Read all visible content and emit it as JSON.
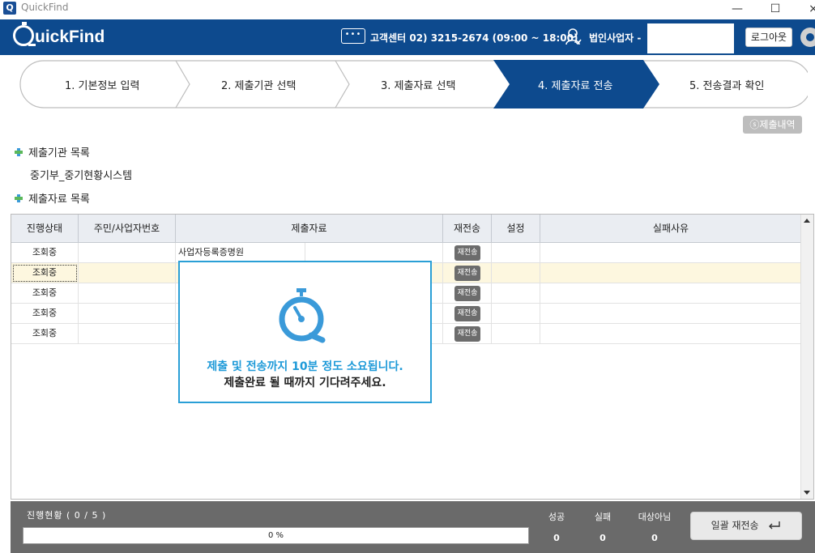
{
  "window": {
    "title": "QuickFind",
    "app_icon_glyph": "Q",
    "minimize": "—",
    "maximize": "☐",
    "close": "×"
  },
  "header": {
    "logo": "uickFind",
    "chat_glyph": "•••",
    "support": "고객센터 02) 3215-2674 (09:00 ~ 18:00)",
    "user_label": "법인사업자 -",
    "user_value": "",
    "logout": "로그아웃",
    "accent": "#0d4a8e"
  },
  "steps": [
    {
      "label": "1. 기본정보 입력",
      "active": false
    },
    {
      "label": "2. 제출기관 선택",
      "active": false
    },
    {
      "label": "3. 제출자료 선택",
      "active": false
    },
    {
      "label": "4. 제출자료 전송",
      "active": true
    },
    {
      "label": "5. 전송결과 확인",
      "active": false
    }
  ],
  "history_button": "ⓢ제출내역",
  "sections": {
    "agency_list_title": "제출기관 목록",
    "agency_name": "중기부_중기현황시스템",
    "doc_list_title": "제출자료 목록"
  },
  "table": {
    "columns": [
      "진행상태",
      "주민/사업자번호",
      "제출자료",
      "재전송",
      "설정",
      "실패사유"
    ],
    "rows": [
      {
        "status": "조회중",
        "id": "",
        "doc": "사업자등록증명원",
        "resend": "재전송",
        "setting": "",
        "reason": ""
      },
      {
        "status": "조회중",
        "id": "",
        "doc": "",
        "resend": "재전송",
        "setting": "",
        "reason": ""
      },
      {
        "status": "조회중",
        "id": "",
        "doc": "",
        "resend": "재전송",
        "setting": "",
        "reason": ""
      },
      {
        "status": "조회중",
        "id": "",
        "doc": "",
        "resend": "재전송",
        "setting": "",
        "reason": ""
      },
      {
        "status": "조회중",
        "id": "",
        "doc": "",
        "resend": "재전송",
        "setting": "",
        "reason": ""
      }
    ]
  },
  "modal": {
    "line1": "제출 및 전송까지 10분 정도 소요됩니다.",
    "line2": "제출완료 될 때까지 기다려주세요.",
    "accent": "#2a9fd6"
  },
  "footer": {
    "progress_text": "진행현황 ( 0 / 5 )",
    "progress_percent": 0,
    "progress_label": "0 %",
    "stats": [
      {
        "label": "성공",
        "value": "0"
      },
      {
        "label": "실패",
        "value": "0"
      },
      {
        "label": "대상아님",
        "value": "0"
      }
    ],
    "bulk_resend": "일괄 재전송"
  }
}
